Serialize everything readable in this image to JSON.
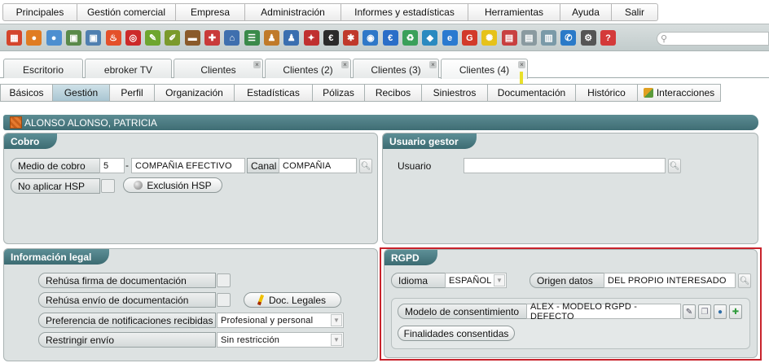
{
  "menu": [
    {
      "key": "principales",
      "label": "Principales"
    },
    {
      "key": "gestion-comercial",
      "label": "Gestión comercial"
    },
    {
      "key": "empresa",
      "label": "Empresa"
    },
    {
      "key": "administracion",
      "label": "Administración"
    },
    {
      "key": "informes",
      "label": "Informes y estadísticas"
    },
    {
      "key": "herramientas",
      "label": "Herramientas"
    },
    {
      "key": "ayuda",
      "label": "Ayuda"
    },
    {
      "key": "salir",
      "label": "Salir"
    }
  ],
  "toolbar": {
    "icons": [
      {
        "name": "cube-icon",
        "glyph": "▦",
        "color": "#d4452c"
      },
      {
        "name": "user-orange-icon",
        "glyph": "●",
        "color": "#e07c22"
      },
      {
        "name": "user-blue-icon",
        "glyph": "●",
        "color": "#4d8fd0"
      },
      {
        "name": "image-icon",
        "glyph": "▣",
        "color": "#5a8a4a"
      },
      {
        "name": "picture-icon",
        "glyph": "▣",
        "color": "#4f7fb0"
      },
      {
        "name": "fire-icon",
        "glyph": "♨",
        "color": "#e4502a"
      },
      {
        "name": "target-icon",
        "glyph": "◎",
        "color": "#cc2a2a"
      },
      {
        "name": "pencil-icon",
        "glyph": "✎",
        "color": "#6ea62f"
      },
      {
        "name": "paint-icon",
        "glyph": "✐",
        "color": "#7b9a2c"
      },
      {
        "name": "briefcase-icon",
        "glyph": "▬",
        "color": "#8a5a2a"
      },
      {
        "name": "gift-icon",
        "glyph": "✚",
        "color": "#c93a3a"
      },
      {
        "name": "house-icon",
        "glyph": "⌂",
        "color": "#3f6fae"
      },
      {
        "name": "phone-list-icon",
        "glyph": "☰",
        "color": "#3a8a4a"
      },
      {
        "name": "person-icon",
        "glyph": "♟",
        "color": "#c07a2a"
      },
      {
        "name": "person-blue-icon",
        "glyph": "♟",
        "color": "#3a6fb0"
      },
      {
        "name": "grid-icon",
        "glyph": "✦",
        "color": "#c03030"
      },
      {
        "name": "euro-icon",
        "glyph": "€",
        "color": "#2a2a2a"
      },
      {
        "name": "group-icon",
        "glyph": "✱",
        "color": "#c0392b"
      },
      {
        "name": "globe-icon",
        "glyph": "◉",
        "color": "#2f78c8"
      },
      {
        "name": "euro-blue-icon",
        "glyph": "€",
        "color": "#2a6ec8"
      },
      {
        "name": "recycle-icon",
        "glyph": "♻",
        "color": "#3aa05a"
      },
      {
        "name": "arrows-icon",
        "glyph": "◆",
        "color": "#2a8ac0"
      },
      {
        "name": "browser-icon",
        "glyph": "e",
        "color": "#2a7ad0"
      },
      {
        "name": "google-icon",
        "glyph": "G",
        "color": "#d23a2a"
      },
      {
        "name": "bulb-icon",
        "glyph": "✺",
        "color": "#e6c21a"
      },
      {
        "name": "calendar-icon",
        "glyph": "▤",
        "color": "#c84040"
      },
      {
        "name": "notes-icon",
        "glyph": "▤",
        "color": "#8a9aa0"
      },
      {
        "name": "document-icon",
        "glyph": "▥",
        "color": "#7a9aa8"
      },
      {
        "name": "handset-icon",
        "glyph": "✆",
        "color": "#2a7ac8"
      },
      {
        "name": "tools-icon",
        "glyph": "⚙",
        "color": "#555555"
      },
      {
        "name": "help-icon",
        "glyph": "?",
        "color": "#d43a3a"
      }
    ]
  },
  "record_tabs": [
    {
      "key": "escritorio",
      "label": "Escritorio"
    },
    {
      "key": "ebroker-tv",
      "label": "ebroker TV"
    },
    {
      "key": "clientes",
      "label": "Clientes"
    },
    {
      "key": "clientes-2",
      "label": "Clientes (2)"
    },
    {
      "key": "clientes-3",
      "label": "Clientes (3)"
    },
    {
      "key": "clientes-4",
      "label": "Clientes (4)"
    }
  ],
  "close_glyph": "×",
  "sub_tabs": [
    {
      "key": "basicos",
      "label": "Básicos"
    },
    {
      "key": "gestion",
      "label": "Gestión"
    },
    {
      "key": "perfil",
      "label": "Perfil"
    },
    {
      "key": "organizacion",
      "label": "Organización"
    },
    {
      "key": "estadisticas",
      "label": "Estadísticas"
    },
    {
      "key": "polizas",
      "label": "Pólizas"
    },
    {
      "key": "recibos",
      "label": "Recibos"
    },
    {
      "key": "siniestros",
      "label": "Siniestros"
    },
    {
      "key": "documentacion",
      "label": "Documentación"
    },
    {
      "key": "historico",
      "label": "Histórico"
    },
    {
      "key": "interacciones",
      "label": "Interacciones"
    }
  ],
  "client": {
    "name": "ALONSO ALONSO, PATRICIA"
  },
  "cobro": {
    "title": "Cobro",
    "medio_label": "Medio de cobro",
    "medio_code": "5",
    "medio_sep": "-",
    "medio_value": "COMPAÑIA EFECTIVO",
    "canal_label": "Canal",
    "canal_value": "COMPAÑIA",
    "no_hsp_label": "No aplicar HSP",
    "exclusion_button": "Exclusión HSP"
  },
  "usuario": {
    "title": "Usuario gestor",
    "label": "Usuario",
    "value": ""
  },
  "legal": {
    "title": "Información legal",
    "rehusa_firma_label": "Rehúsa firma de documentación",
    "rehusa_envio_label": "Rehúsa envío de documentación",
    "doc_legales_button": "Doc. Legales",
    "pref_label": "Preferencia de notificaciones recibidas",
    "pref_value": "Profesional y personal",
    "restringir_label": "Restringir envío",
    "restringir_value": "Sin restricción"
  },
  "rgpd": {
    "title": "RGPD",
    "idioma_label": "Idioma",
    "idioma_value": "ESPAÑOL",
    "origen_label": "Origen datos",
    "origen_value": "DEL PROPIO INTERESADO",
    "modelo_label": "Modelo de consentimiento",
    "modelo_value": "ALEX - MODELO RGPD - DEFECTO",
    "finalidades_button": "Finalidades consentidas"
  },
  "glyphs": {
    "lookup": "🔍︎",
    "dropdown": "▼",
    "search": "⚲",
    "edit": "✎",
    "copy": "❐",
    "people": "●",
    "add": "✚"
  },
  "colors": {
    "panel_header": "#3c6b72",
    "active_subtab": "#a9c6d2",
    "highlight": "#c8232c"
  }
}
